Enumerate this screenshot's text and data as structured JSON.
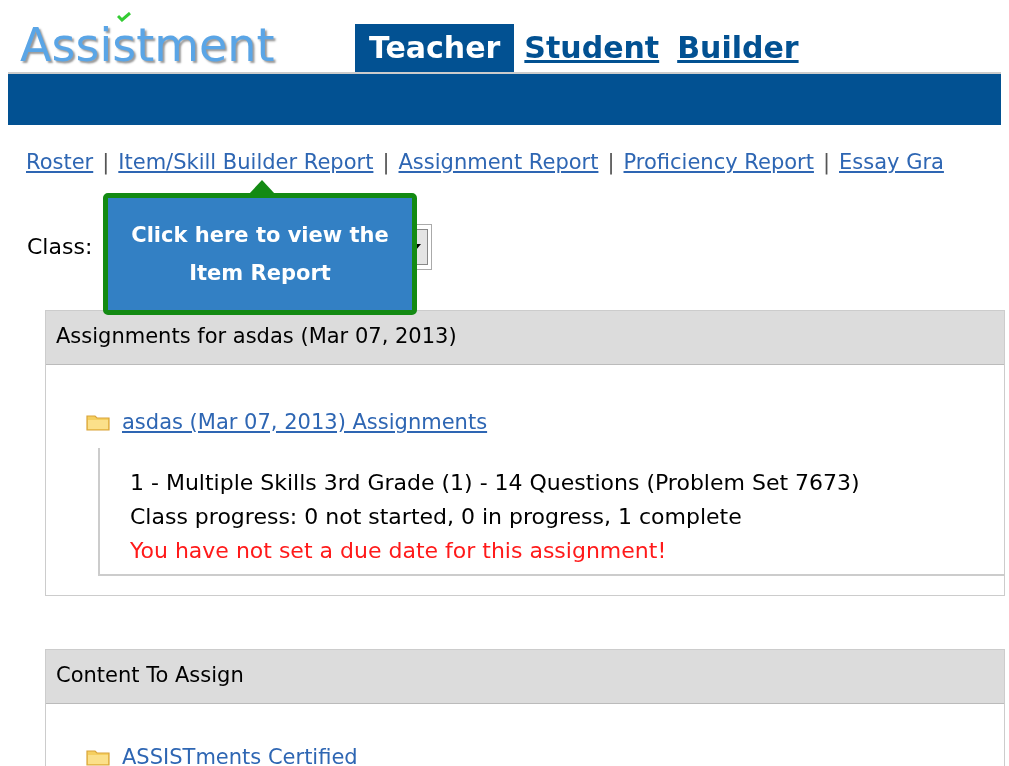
{
  "logo": {
    "text": "Assistment"
  },
  "tabs": [
    {
      "label": "Teacher",
      "selected": true
    },
    {
      "label": "Student",
      "selected": false
    },
    {
      "label": "Builder",
      "selected": false
    }
  ],
  "nav_links": [
    {
      "kind": "link",
      "text": "Roster"
    },
    {
      "kind": "separator",
      "text": "|"
    },
    {
      "kind": "link",
      "text": "Item/Skill Builder Report"
    },
    {
      "kind": "separator",
      "text": "|"
    },
    {
      "kind": "link",
      "text": "Assignment Report"
    },
    {
      "kind": "separator",
      "text": "|"
    },
    {
      "kind": "link",
      "text": "Proficiency Report"
    },
    {
      "kind": "separator",
      "text": "|"
    },
    {
      "kind": "link",
      "text": "Essay Gra"
    }
  ],
  "class_select": {
    "label": "Class:"
  },
  "tooltip": {
    "text": "Click here to view the Item Report"
  },
  "assignments_panel": {
    "title": "Assignments for asdas (Mar 07, 2013)",
    "folder": "asdas (Mar 07, 2013) Assignments",
    "items": [
      {
        "kind": "normal",
        "text": "1 - Multiple Skills 3rd Grade (1) - 14 Questions (Problem Set 7673)"
      },
      {
        "kind": "normal",
        "text": "Class progress: 0 not started, 0 in progress, 1 complete"
      },
      {
        "kind": "warning",
        "text": "You have not set a due date for this assignment!"
      }
    ]
  },
  "content_panel": {
    "title": "Content To Assign",
    "folder": "ASSISTments Certified"
  }
}
